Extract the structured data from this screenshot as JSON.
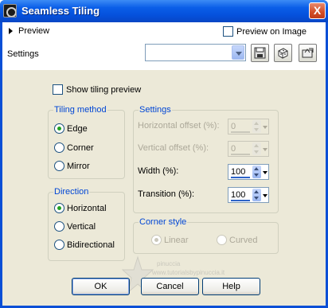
{
  "window": {
    "title": "Seamless Tiling",
    "close": "X"
  },
  "toolbar": {
    "preview_label": "Preview",
    "preview_on_image_label": "Preview on Image",
    "settings_label": "Settings",
    "settings_value": ""
  },
  "show_tiling_preview_label": "Show tiling preview",
  "tiling_method": {
    "title": "Tiling method",
    "options": [
      {
        "label": "Edge",
        "selected": true
      },
      {
        "label": "Corner",
        "selected": false
      },
      {
        "label": "Mirror",
        "selected": false
      }
    ]
  },
  "direction": {
    "title": "Direction",
    "options": [
      {
        "label": "Horizontal",
        "selected": true
      },
      {
        "label": "Vertical",
        "selected": false
      },
      {
        "label": "Bidirectional",
        "selected": false
      }
    ]
  },
  "settings_group": {
    "title": "Settings",
    "horizontal_offset": {
      "label": "Horizontal offset (%):",
      "value": "0",
      "enabled": false
    },
    "vertical_offset": {
      "label": "Vertical offset (%):",
      "value": "0",
      "enabled": false
    },
    "width": {
      "label": "Width (%):",
      "value": "100",
      "enabled": true
    },
    "transition": {
      "label": "Transition (%):",
      "value": "100",
      "enabled": true
    }
  },
  "corner_style": {
    "title": "Corner style",
    "options": [
      {
        "label": "Linear",
        "selected": true,
        "enabled": false
      },
      {
        "label": "Curved",
        "selected": false,
        "enabled": false
      }
    ]
  },
  "buttons": {
    "ok": "OK",
    "cancel": "Cancel",
    "help": "Help"
  },
  "watermark": {
    "line1": "pinuccia",
    "line2": "www.tutorialsbypinuccia.it"
  },
  "colors": {
    "titlebar": "#0a5ee8",
    "face": "#ece9d8",
    "group_title": "#0046d5",
    "radio_dot": "#21a121"
  }
}
